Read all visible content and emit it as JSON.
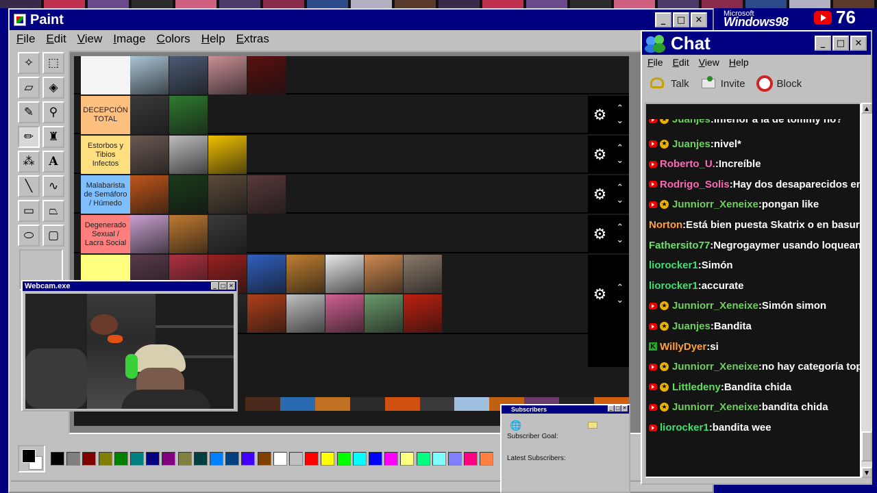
{
  "paint": {
    "title": "Paint",
    "menu": [
      "File",
      "Edit",
      "View",
      "Image",
      "Colors",
      "Help",
      "Extras"
    ],
    "tools": [
      "free-select",
      "rect-select",
      "eraser",
      "fill",
      "color-picker",
      "magnifier",
      "pencil",
      "brush",
      "airbrush",
      "text",
      "line",
      "curve",
      "rectangle",
      "polygon",
      "ellipse",
      "rounded-rect"
    ],
    "palette": [
      "#000000",
      "#808080",
      "#800000",
      "#808000",
      "#008000",
      "#008080",
      "#000080",
      "#800080",
      "#808040",
      "#004040",
      "#0080ff",
      "#004080",
      "#4000ff",
      "#804000",
      "#ffffff",
      "#c0c0c0",
      "#ff0000",
      "#ffff00",
      "#00ff00",
      "#00ffff",
      "#0000ff",
      "#ff00ff",
      "#ffff80",
      "#00ff80",
      "#80ffff",
      "#8080ff",
      "#ff0080",
      "#ff8040"
    ]
  },
  "tiers": [
    {
      "label": "",
      "color": "#f4f4f4",
      "tiles": [
        "#a9c4d6",
        "#4b5a73",
        "#c98f95",
        "#5a1010"
      ]
    },
    {
      "label": "DECEPCIÓN TOTAL",
      "color": "#ffbf7f",
      "tiles": [
        "#3b3b3b",
        "#2f7a2f"
      ]
    },
    {
      "label": "Estorbos y Tibios Infectos",
      "color": "#ffdf7f",
      "tiles": [
        "#6b5a52",
        "#bdbdbd",
        "#f0c000"
      ]
    },
    {
      "label": "Malabarista de Semáforo / Húmedo",
      "color": "#7fbfff",
      "tiles": [
        "#c0561a",
        "#1a3a1a",
        "#5a4a3a",
        "#5a3a3a"
      ]
    },
    {
      "label": "Degenerado Sexual / Lacra Social",
      "color": "#ff7f7f",
      "tiles": [
        "#c9a0d0",
        "#c07a30",
        "#3a3a3a"
      ]
    },
    {
      "label": "",
      "color": "#ffff7f",
      "tiles": [
        "#5a3a4a",
        "#b03040",
        "#9a2020",
        "#3060c0",
        "#c08030",
        "#e8e8e8",
        "#d08a50",
        "#8a7a6a",
        "#bcd6e8",
        "#7ab0e0",
        "#3a8ae0",
        "#4a4a4a",
        "#4a4a4a",
        "#b0b0b0",
        "#8a8a8a",
        "#2a2a2a",
        "#b0401a",
        "#c0c0c0",
        "#d06090",
        "#6a9a6a",
        "#c02010"
      ]
    }
  ],
  "webcam": {
    "title": "Webcam.exe"
  },
  "subscribers": {
    "title": "Subscribers",
    "goal_label": "Subscriber Goal:",
    "latest_label": "Latest Subscribers:"
  },
  "banner": {
    "microsoft": "Microsoft",
    "windows": "Windows98",
    "yt_count": "76"
  },
  "chat": {
    "title": "Chat",
    "menu": [
      "File",
      "Edit",
      "View",
      "Help"
    ],
    "toolbar": [
      "Talk",
      "Invite",
      "Block"
    ],
    "messages": [
      {
        "user": "Juanjes",
        "text": "inferior a la de tommy no?",
        "color": "#6fcf5f",
        "badges": [
          "yt",
          "star"
        ]
      },
      {
        "user": "Juanjes",
        "text": "nivel*",
        "color": "#6fcf5f",
        "badges": [
          "yt",
          "star"
        ]
      },
      {
        "user": "Roberto_U.",
        "text": "Increíble",
        "color": "#ff69b4",
        "badges": [
          "yt"
        ]
      },
      {
        "user": "Rodrigo_Solis",
        "text": "Hay dos desaparecidos en la ti",
        "color": "#ff69b4",
        "badges": [
          "yt"
        ]
      },
      {
        "user": "Junniorr_Xeneixe",
        "text": "pongan like",
        "color": "#6fcf5f",
        "badges": [
          "yt",
          "star"
        ]
      },
      {
        "user": "Norton",
        "text": "Está bien puesta Skatrix o en basura d",
        "color": "#ffa040",
        "badges": []
      },
      {
        "user": "Fathersito77",
        "text": "Negrogaymer usando loqueand",
        "color": "#6fdf6f",
        "badges": []
      },
      {
        "user": "liorocker1",
        "text": "Simón",
        "color": "#40e070",
        "badges": []
      },
      {
        "user": "liorocker1",
        "text": "accurate",
        "color": "#40e070",
        "badges": []
      },
      {
        "user": "Junniorr_Xeneixe",
        "text": "Simón simon",
        "color": "#6fcf5f",
        "badges": [
          "yt",
          "star"
        ]
      },
      {
        "user": "Juanjes",
        "text": "Bandita",
        "color": "#6fcf5f",
        "badges": [
          "yt",
          "star"
        ]
      },
      {
        "user": "WillyDyer",
        "text": "si",
        "color": "#ffa040",
        "badges": [
          "k"
        ]
      },
      {
        "user": "Junniorr_Xeneixe",
        "text": "no hay categoría topo",
        "color": "#6fcf5f",
        "badges": [
          "yt",
          "star"
        ]
      },
      {
        "user": "Littledeny",
        "text": "Bandita chida",
        "color": "#5fe060",
        "badges": [
          "yt",
          "star"
        ]
      },
      {
        "user": "Junniorr_Xeneixe",
        "text": "bandita chida",
        "color": "#6fcf5f",
        "badges": [
          "yt",
          "star"
        ]
      },
      {
        "user": "liorocker1",
        "text": "bandita wee",
        "color": "#40e070",
        "badges": [
          "yt"
        ]
      }
    ]
  }
}
